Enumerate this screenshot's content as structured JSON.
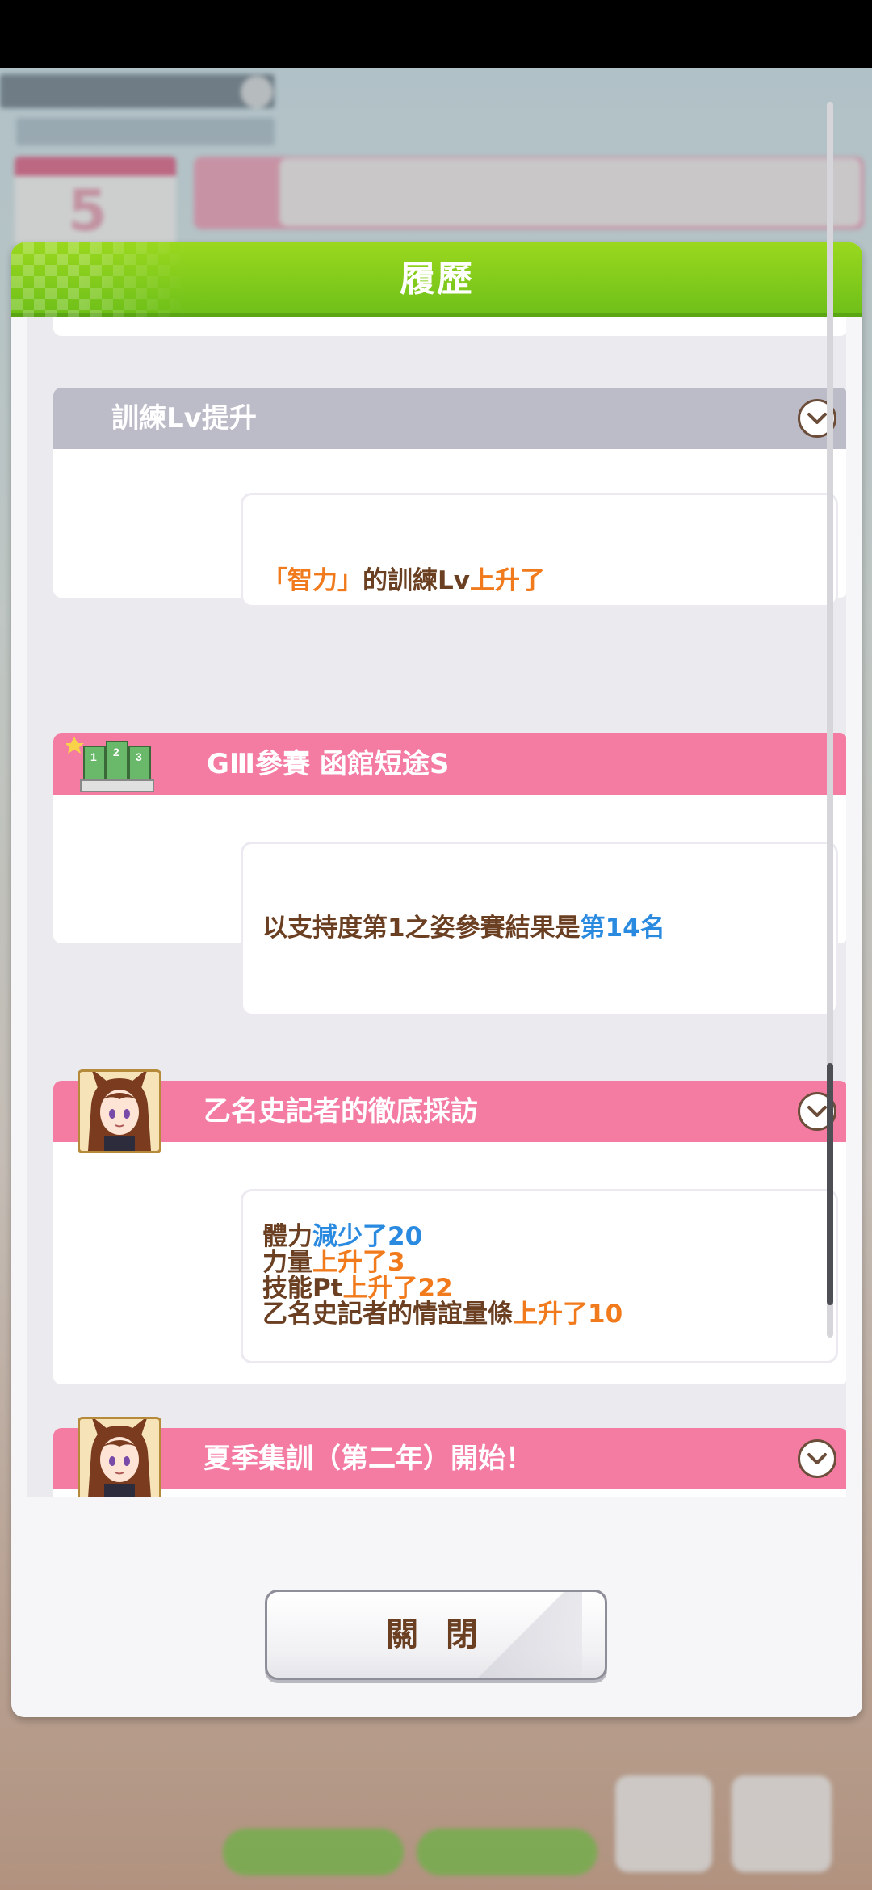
{
  "dialog": {
    "title": "履歷",
    "close_label": "關 閉"
  },
  "history": [
    {
      "type": "training",
      "header_color": "grey",
      "title": "訓練Lv提升",
      "lines": [
        [
          {
            "text": "「智力」",
            "color": "orange"
          },
          {
            "text": "的訓練Lv",
            "color": "brown"
          },
          {
            "text": "上升了",
            "color": "orange"
          }
        ]
      ]
    },
    {
      "type": "race",
      "header_color": "pink",
      "title": "GⅢ參賽 函館短途S",
      "icon": "race-ranking-icon",
      "lines": [
        [
          {
            "text": "以支持度第1之姿參賽結果是",
            "color": "brown"
          },
          {
            "text": "第14名",
            "color": "blue"
          }
        ]
      ]
    },
    {
      "type": "event",
      "header_color": "pink",
      "title": "乙名史記者的徹底採訪",
      "icon": "character-portrait",
      "lines": [
        [
          {
            "text": "體力",
            "color": "brown"
          },
          {
            "text": "減少了20",
            "color": "blue"
          }
        ],
        [
          {
            "text": "力量",
            "color": "brown"
          },
          {
            "text": "上升了3",
            "color": "orange"
          }
        ],
        [
          {
            "text": "技能Pt",
            "color": "brown"
          },
          {
            "text": "上升了22",
            "color": "orange"
          }
        ],
        [
          {
            "text": "乙名史記者的情誼量條",
            "color": "brown"
          },
          {
            "text": "上升了10",
            "color": "orange"
          }
        ]
      ]
    },
    {
      "type": "event",
      "header_color": "pink",
      "title": "夏季集訓（第二年）開始！",
      "icon": "character-portrait"
    }
  ],
  "colors": {
    "header_green": "#7cc81c",
    "card_pink": "#f47ca3",
    "card_grey": "#bcbcc8",
    "text_brown": "#6b3f22",
    "text_orange": "#f07a1c",
    "text_blue": "#2a8ae0"
  },
  "scroll": {
    "position_fraction": 0.82
  }
}
